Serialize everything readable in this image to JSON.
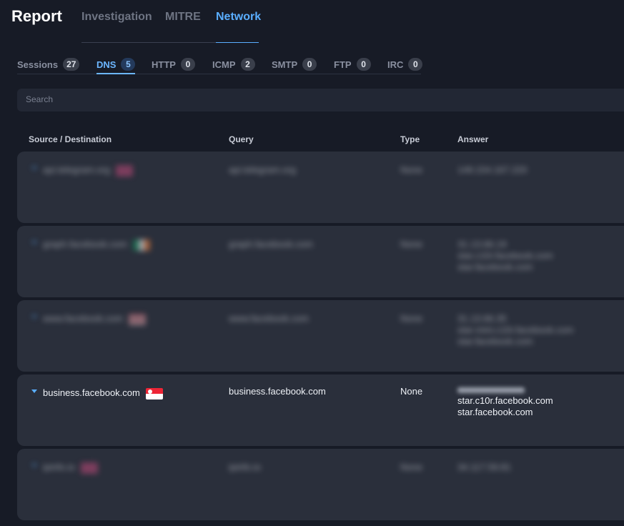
{
  "header": {
    "title": "Report",
    "tabs": [
      {
        "label": "Investigation"
      },
      {
        "label": "MITRE"
      },
      {
        "label": "Network"
      }
    ]
  },
  "subtabs": [
    {
      "label": "Sessions",
      "count": "27"
    },
    {
      "label": "DNS",
      "count": "5"
    },
    {
      "label": "HTTP",
      "count": "0"
    },
    {
      "label": "ICMP",
      "count": "2"
    },
    {
      "label": "SMTP",
      "count": "0"
    },
    {
      "label": "FTP",
      "count": "0"
    },
    {
      "label": "IRC",
      "count": "0"
    }
  ],
  "search": {
    "placeholder": "Search"
  },
  "table": {
    "columns": [
      "Source / Destination",
      "Query",
      "Type",
      "Answer"
    ],
    "rows": [
      {
        "source": "api.telegram.org",
        "query": "api.telegram.org",
        "type": "None",
        "answers": [
          "149.154.167.220"
        ],
        "flag": "flag-pink",
        "blurred": true
      },
      {
        "source": "graph.facebook.com",
        "query": "graph.facebook.com",
        "type": "None",
        "answers": [
          "31.13.66.19",
          "star.c10r.facebook.com",
          "star.facebook.com"
        ],
        "flag": "flag-ireland",
        "blurred": true
      },
      {
        "source": "www.facebook.com",
        "query": "www.facebook.com",
        "type": "None",
        "answers": [
          "31.13.66.35",
          "star-mini.c10r.facebook.com",
          "star.facebook.com"
        ],
        "flag": "flag-us",
        "blurred": true
      },
      {
        "source": "business.facebook.com",
        "query": "business.facebook.com",
        "type": "None",
        "answers": [
          "star.c10r.facebook.com",
          "star.facebook.com"
        ],
        "flag": "flag-singapore",
        "blurred": false
      },
      {
        "source": "ipinfo.io",
        "query": "ipinfo.io",
        "type": "None",
        "answers": [
          "34.117.59.81"
        ],
        "flag": "flag-pink",
        "blurred": true
      }
    ]
  },
  "colors": {
    "accent": "#5aaeff",
    "background": "#171b26",
    "row_bg": "#2a2f3b"
  }
}
